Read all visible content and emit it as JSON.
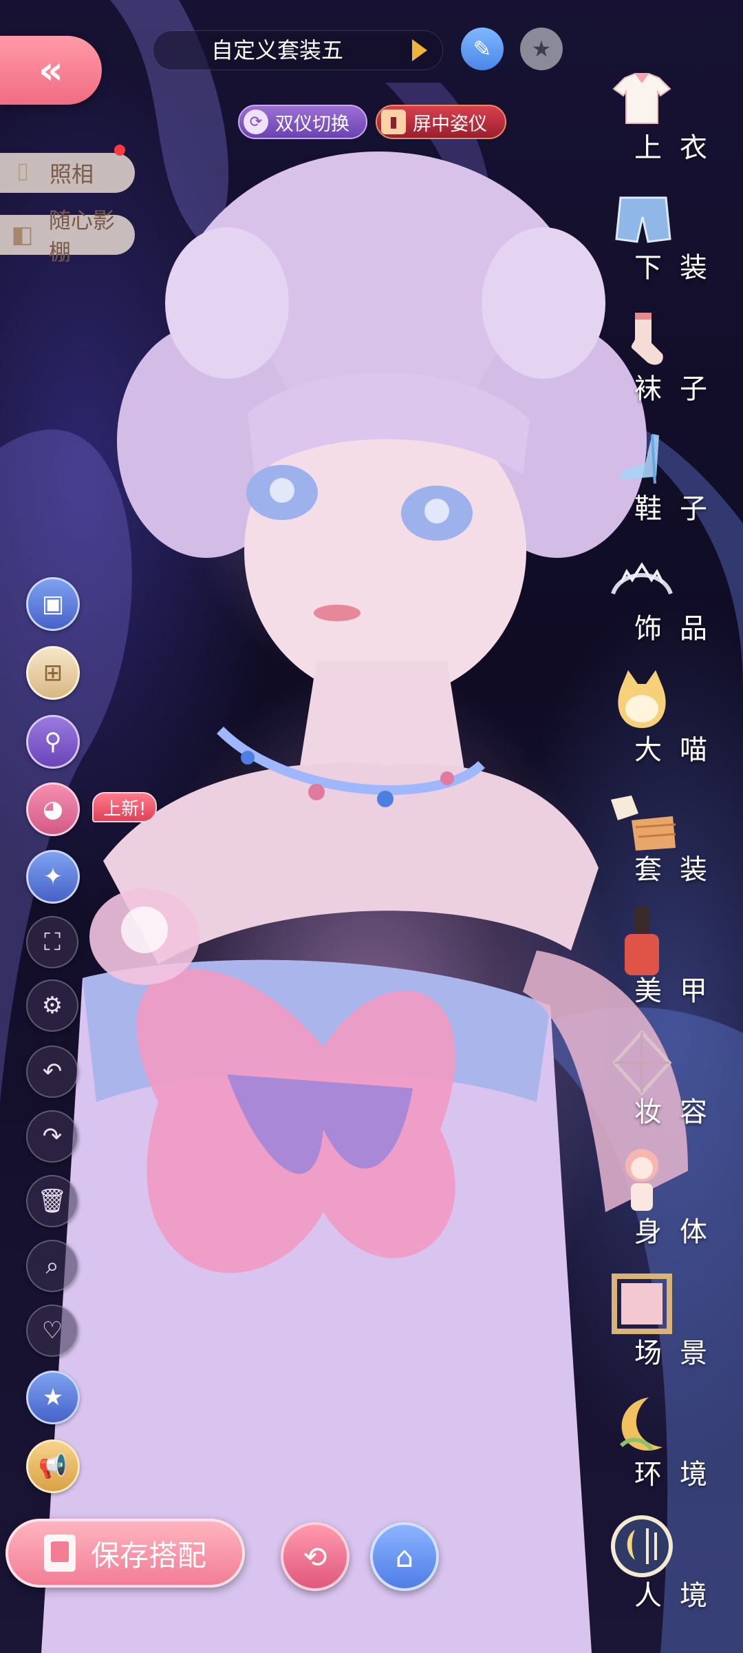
{
  "header": {
    "back_icon": "double-chevron-left-icon",
    "outfit_name": "自定义套装五",
    "edit_icon": "pencil-icon",
    "favorite_icon": "star-icon"
  },
  "mode_buttons": {
    "swap": "双仪切换",
    "pose": "屏中姿仪"
  },
  "left_tags": {
    "photo": "照相",
    "studio": "随心影棚"
  },
  "left_tools": {
    "new_badge": "上新!"
  },
  "categories": [
    {
      "label": "上衣",
      "icon": "shirt-icon"
    },
    {
      "label": "下装",
      "icon": "shorts-icon"
    },
    {
      "label": "袜子",
      "icon": "sock-icon"
    },
    {
      "label": "鞋子",
      "icon": "shoe-icon"
    },
    {
      "label": "饰品",
      "icon": "tiara-icon"
    },
    {
      "label": "大喵",
      "icon": "cat-icon"
    },
    {
      "label": "套装",
      "icon": "outfit-set-icon"
    },
    {
      "label": "美甲",
      "icon": "nail-polish-icon"
    },
    {
      "label": "妆容",
      "icon": "makeup-icon"
    },
    {
      "label": "身体",
      "icon": "doll-icon"
    },
    {
      "label": "场景",
      "icon": "picture-frame-icon"
    },
    {
      "label": "环境",
      "icon": "moon-icon"
    },
    {
      "label": "人境",
      "icon": "portal-icon"
    }
  ],
  "footer": {
    "save_label": "保存搭配"
  },
  "colors": {
    "accent_pink": "#f27d95",
    "accent_blue": "#4e7ee6",
    "background": "#0f0c24"
  }
}
